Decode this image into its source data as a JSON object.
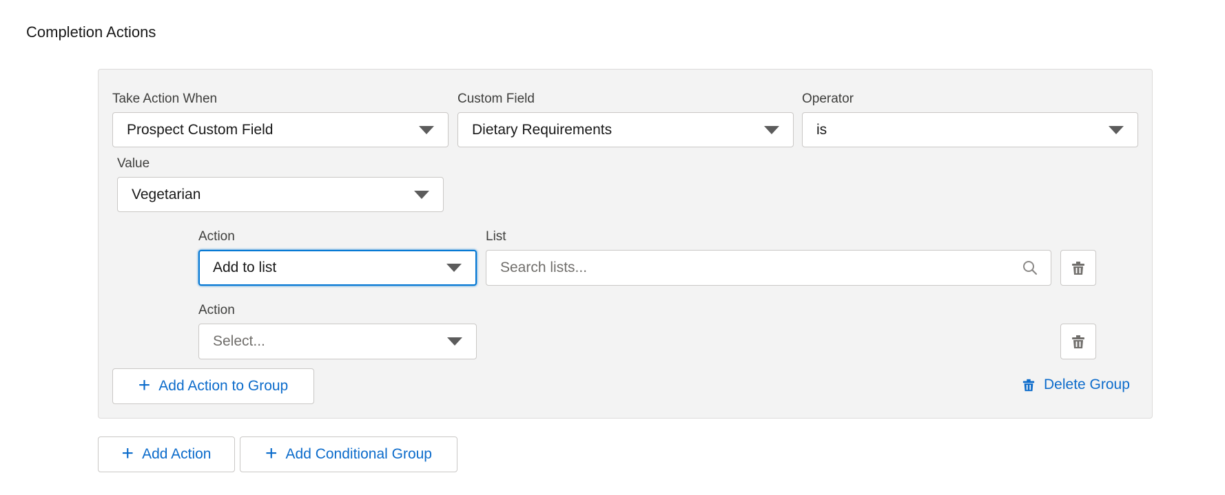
{
  "page": {
    "title": "Completion Actions"
  },
  "condition": {
    "take_action_when": {
      "label": "Take Action When",
      "value": "Prospect Custom Field"
    },
    "custom_field": {
      "label": "Custom Field",
      "value": "Dietary Requirements"
    },
    "operator": {
      "label": "Operator",
      "value": "is"
    },
    "value": {
      "label": "Value",
      "value": "Vegetarian"
    }
  },
  "actions": [
    {
      "label": "Action",
      "value": "Add to list",
      "list_label": "List",
      "list_placeholder": "Search lists..."
    },
    {
      "label": "Action",
      "placeholder": "Select..."
    }
  ],
  "group_buttons": {
    "add_action_to_group": "Add Action to Group",
    "delete_group": "Delete Group"
  },
  "footer_buttons": {
    "add_action": "Add Action",
    "add_conditional_group": "Add Conditional Group"
  },
  "icons": {
    "caret": "chevron-down-icon",
    "search": "search-icon",
    "trash": "trash-icon",
    "plus": "plus-icon"
  },
  "colors": {
    "accent": "#0b6bcb",
    "focus": "#0176d3",
    "panel_bg": "#f3f3f3",
    "border": "#c9c7c5"
  }
}
